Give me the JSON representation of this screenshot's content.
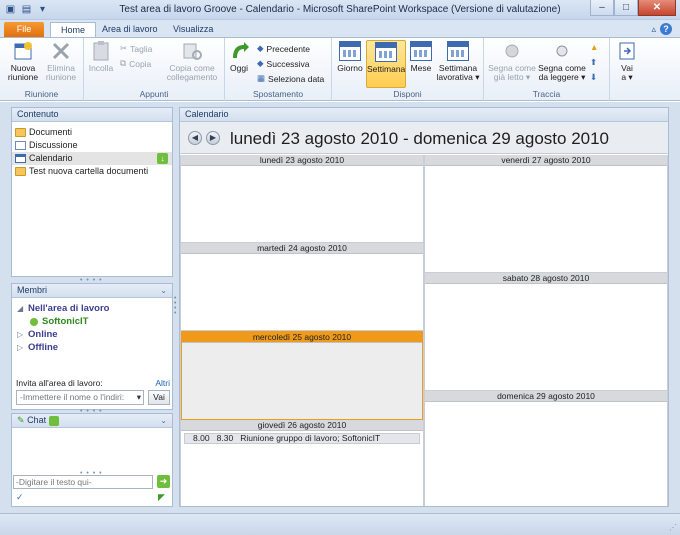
{
  "window": {
    "title": "Test area di lavoro Groove - Calendario - Microsoft SharePoint Workspace (Versione di valutazione)",
    "minimize": "–",
    "maximize": "□",
    "close": "✕"
  },
  "tabs": {
    "file": "File",
    "home": "Home",
    "area": "Area di lavoro",
    "view": "Visualizza"
  },
  "ribbon": {
    "riunione": {
      "label": "Riunione",
      "nuova_line1": "Nuova",
      "nuova_line2": "riunione",
      "elimina_line1": "Elimina",
      "elimina_line2": "riunione"
    },
    "appunti": {
      "label": "Appunti",
      "incolla": "Incolla",
      "taglia": "Taglia",
      "copia": "Copia",
      "copia_come_line1": "Copia come",
      "copia_come_line2": "collegamento"
    },
    "spostamento": {
      "label": "Spostamento",
      "oggi": "Oggi",
      "precedente": "Precedente",
      "successiva": "Successiva",
      "seleziona_data": "Seleziona data"
    },
    "disponi": {
      "label": "Disponi",
      "giorno": "Giorno",
      "settimana": "Settimana",
      "mese": "Mese",
      "sett_lav_line1": "Settimana",
      "sett_lav_line2": "lavorativa ▾"
    },
    "traccia": {
      "label": "Traccia",
      "segna_letto_line1": "Segna come",
      "segna_letto_line2": "già letto ▾",
      "segna_leggere_line1": "Segna come",
      "segna_leggere_line2": "da leggere ▾"
    },
    "vai": {
      "line1": "Vai",
      "line2": "a ▾"
    }
  },
  "contenuto": {
    "title": "Contenuto",
    "items": [
      {
        "label": "Documenti",
        "icon": "folder-icon"
      },
      {
        "label": "Discussione",
        "icon": "discussion-icon"
      },
      {
        "label": "Calendario",
        "icon": "calendar-icon",
        "selected": true
      },
      {
        "label": "Test nuova cartella documenti",
        "icon": "folder-icon"
      }
    ]
  },
  "membri": {
    "title": "Membri",
    "groups": {
      "nell_area": "Nell'area di lavoro",
      "member": "SoftonicIT",
      "online": "Online",
      "offline": "Offline"
    },
    "invite_label": "Invita all'area di lavoro:",
    "invite_other": "Altri",
    "invite_placeholder": "-Immettere il nome o l'indiri:",
    "vai_button": "Vai"
  },
  "chat": {
    "title": "Chat",
    "placeholder": "-Digitare il testo qui-"
  },
  "calendar": {
    "pane_title": "Calendario",
    "range_title": "lunedì 23 agosto 2010 - domenica 29 agosto 2010",
    "days": {
      "mon": "lunedì 23 agosto 2010",
      "tue": "martedì 24 agosto 2010",
      "wed": "mercoledì 25 agosto 2010",
      "thu": "giovedì 26 agosto 2010",
      "fri": "venerdì 27 agosto 2010",
      "sat": "sabato 28 agosto 2010",
      "sun": "domenica 29 agosto 2010"
    },
    "event": {
      "start": "8.00",
      "end": "8.30",
      "title": "Riunione gruppo di lavoro; SoftonicIT"
    }
  },
  "colors": {
    "accent_orange": "#f09a1c",
    "ribbon_blue": "#dae5f3",
    "member_green": "#2f8a1e"
  }
}
